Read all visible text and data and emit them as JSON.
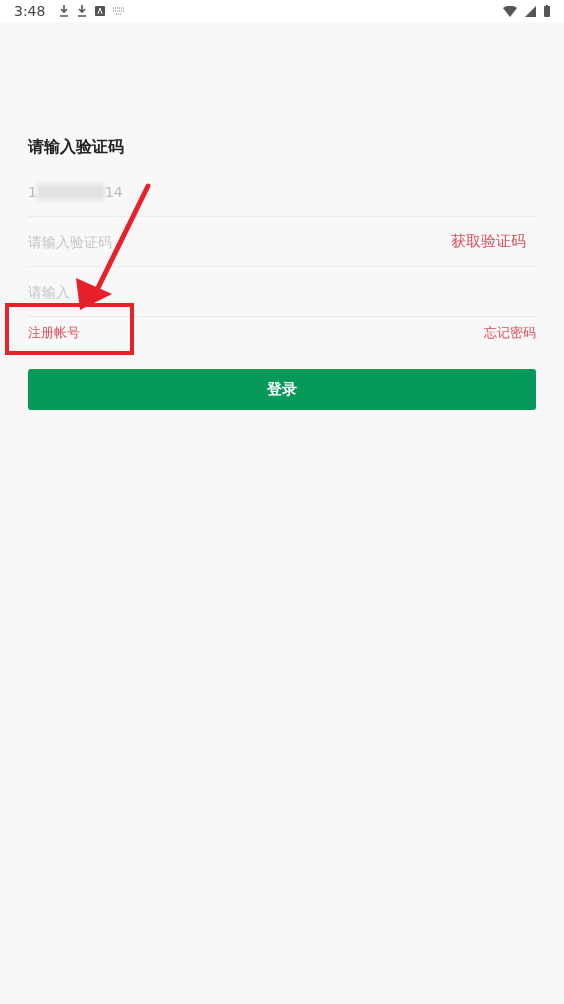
{
  "status_bar": {
    "time": "3:48"
  },
  "title": "请输入验证码",
  "phone": {
    "value_start": "1",
    "value_end": "14"
  },
  "code": {
    "placeholder": "请输入验证码",
    "action": "获取验证码"
  },
  "password": {
    "placeholder": "请输入"
  },
  "links": {
    "register": "注册帐号",
    "forgot": "忘记密码"
  },
  "login_button": "登录"
}
